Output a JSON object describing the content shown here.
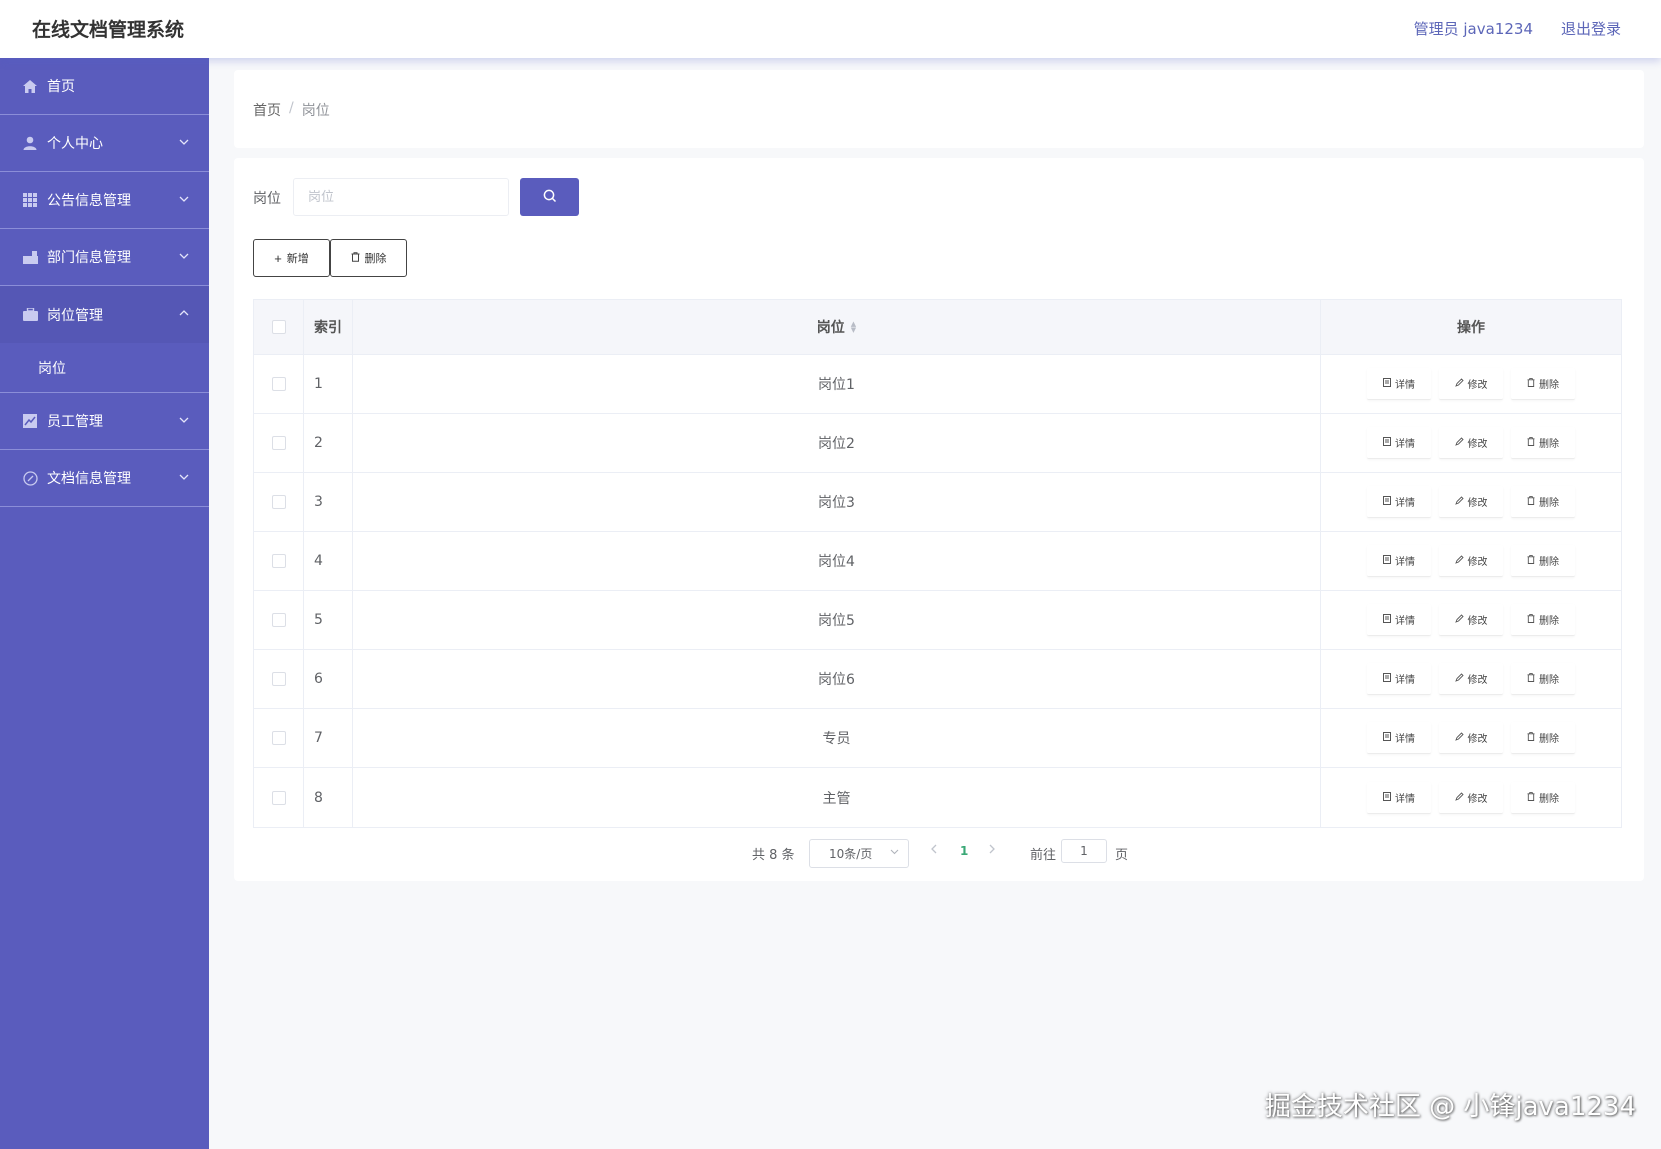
{
  "header": {
    "title": "在线文档管理系统",
    "user": "管理员 java1234",
    "logout": "退出登录"
  },
  "sidebar": {
    "items": [
      {
        "label": "首页",
        "icon": "home-icon",
        "expanded": false
      },
      {
        "label": "个人中心",
        "icon": "user-icon",
        "expanded": false
      },
      {
        "label": "公告信息管理",
        "icon": "grid-icon",
        "expanded": false
      },
      {
        "label": "部门信息管理",
        "icon": "department-icon",
        "expanded": false
      },
      {
        "label": "岗位管理",
        "icon": "briefcase-icon",
        "expanded": true,
        "children": [
          "岗位"
        ]
      },
      {
        "label": "员工管理",
        "icon": "chart-icon",
        "expanded": false
      },
      {
        "label": "文档信息管理",
        "icon": "document-icon",
        "expanded": false
      }
    ]
  },
  "breadcrumb": {
    "home": "首页",
    "separator": "/",
    "current": "岗位"
  },
  "search": {
    "label": "岗位",
    "placeholder": "岗位",
    "value": ""
  },
  "toolbar": {
    "add_label": "新增",
    "delete_label": "删除"
  },
  "table": {
    "columns": {
      "index": "索引",
      "name": "岗位",
      "ops": "操作"
    },
    "rows": [
      {
        "index": "1",
        "name": "岗位1"
      },
      {
        "index": "2",
        "name": "岗位2"
      },
      {
        "index": "3",
        "name": "岗位3"
      },
      {
        "index": "4",
        "name": "岗位4"
      },
      {
        "index": "5",
        "name": "岗位5"
      },
      {
        "index": "6",
        "name": "岗位6"
      },
      {
        "index": "7",
        "name": "专员"
      },
      {
        "index": "8",
        "name": "主管"
      }
    ],
    "row_actions": {
      "detail": "详情",
      "edit": "修改",
      "delete": "删除"
    }
  },
  "pagination": {
    "total": "共 8 条",
    "page_size": "10条/页",
    "current_page": "1",
    "goto_label": "前往",
    "goto_value": "1",
    "goto_unit": "页"
  },
  "watermark": "掘金技术社区 @ 小锋java1234",
  "colors": {
    "accent": "#5a5cbd",
    "sidebar": "#5a5cbd",
    "active_page": "#3aa876"
  }
}
